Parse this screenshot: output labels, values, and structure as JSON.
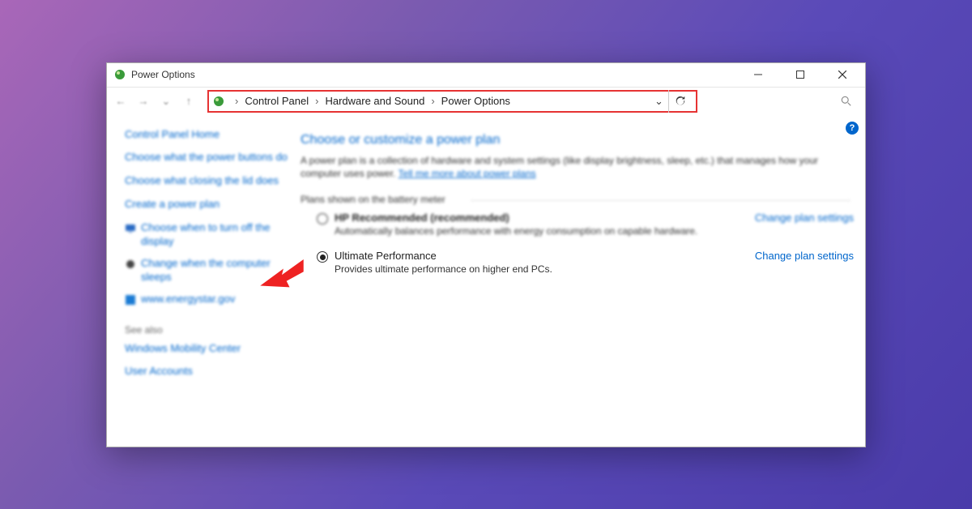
{
  "window": {
    "title": "Power Options"
  },
  "breadcrumb": {
    "items": [
      "Control Panel",
      "Hardware and Sound",
      "Power Options"
    ]
  },
  "sidebar": {
    "home": "Control Panel Home",
    "links": [
      "Choose what the power buttons do",
      "Choose what closing the lid does",
      "Create a power plan",
      "Choose when to turn off the display",
      "Change when the computer sleeps",
      "www.energystar.gov"
    ],
    "see_also_label": "See also",
    "see_also": [
      "Windows Mobility Center",
      "User Accounts"
    ]
  },
  "content": {
    "heading": "Choose or customize a power plan",
    "description": "A power plan is a collection of hardware and system settings (like display brightness, sleep, etc.) that manages how your computer uses power.",
    "desc_link": "Tell me more about power plans",
    "group_label": "Plans shown on the battery meter",
    "plans": [
      {
        "name": "HP Recommended (recommended)",
        "sub": "Automatically balances performance with energy consumption on capable hardware.",
        "change": "Change plan settings",
        "selected": false
      },
      {
        "name": "Ultimate Performance",
        "sub": "Provides ultimate performance on higher end PCs.",
        "change": "Change plan settings",
        "selected": true
      }
    ]
  }
}
